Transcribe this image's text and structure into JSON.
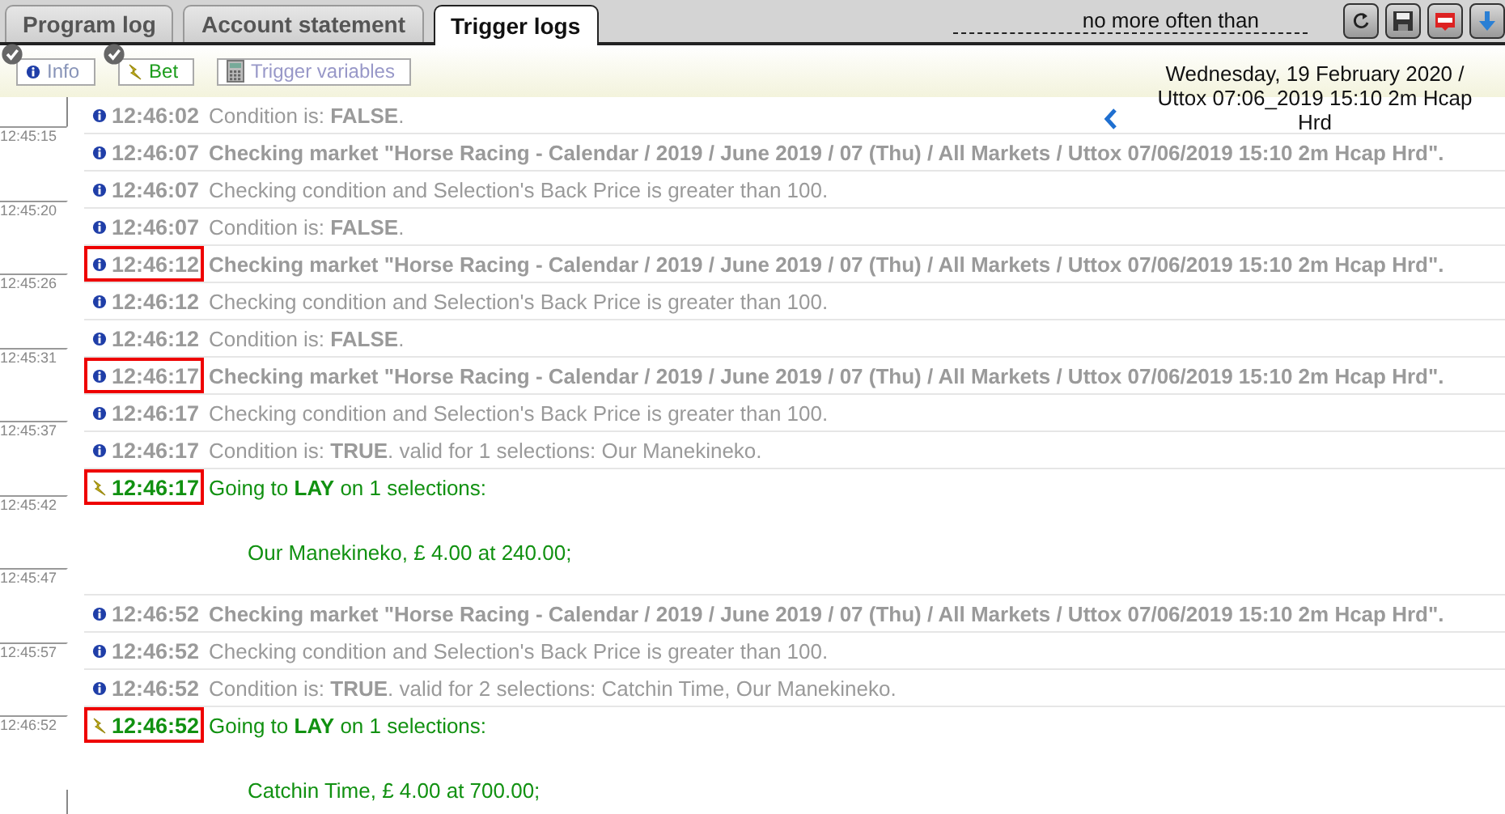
{
  "tabs": [
    {
      "label": "Program log",
      "selected": false
    },
    {
      "label": "Account statement",
      "selected": false
    },
    {
      "label": "Trigger logs",
      "selected": true
    }
  ],
  "throttle": {
    "label": "no more often than"
  },
  "filters": [
    {
      "kind": "info",
      "label": "Info",
      "checked": true
    },
    {
      "kind": "bet",
      "label": "Bet",
      "checked": true
    },
    {
      "kind": "variables",
      "label": "Trigger variables",
      "checked": false
    }
  ],
  "date_header": {
    "text": "Wednesday, 19 February 2020 / Uttox 07:06_2019 15:10 2m Hcap Hrd"
  },
  "gutter_times": [
    "12:45:15",
    "12:45:20",
    "12:45:26",
    "12:45:31",
    "12:45:37",
    "12:45:42",
    "12:45:47",
    "12:45:57",
    "12:46:52"
  ],
  "log": [
    {
      "kind": "info",
      "time": "12:46:02",
      "message": "Condition is: **FALSE**.",
      "bold": false,
      "highlighted": false
    },
    {
      "kind": "info",
      "time": "12:46:07",
      "message": "Checking market \"Horse Racing - Calendar / 2019 / June 2019 / 07 (Thu) / All Markets / Uttox 07/06/2019 15:10 2m Hcap Hrd\".",
      "bold": true,
      "highlighted": false
    },
    {
      "kind": "info",
      "time": "12:46:07",
      "message": "Checking condition and Selection's Back Price is greater than 100.",
      "bold": false,
      "highlighted": false
    },
    {
      "kind": "info",
      "time": "12:46:07",
      "message": "Condition is: **FALSE**.",
      "bold": false,
      "highlighted": false
    },
    {
      "kind": "info",
      "time": "12:46:12",
      "message": "Checking market \"Horse Racing - Calendar / 2019 / June 2019 / 07 (Thu) / All Markets / Uttox 07/06/2019 15:10 2m Hcap Hrd\".",
      "bold": true,
      "highlighted": true
    },
    {
      "kind": "info",
      "time": "12:46:12",
      "message": "Checking condition and Selection's Back Price is greater than 100.",
      "bold": false,
      "highlighted": false
    },
    {
      "kind": "info",
      "time": "12:46:12",
      "message": "Condition is: **FALSE**.",
      "bold": false,
      "highlighted": false
    },
    {
      "kind": "info",
      "time": "12:46:17",
      "message": "Checking market \"Horse Racing - Calendar / 2019 / June 2019 / 07 (Thu) / All Markets / Uttox 07/06/2019 15:10 2m Hcap Hrd\".",
      "bold": true,
      "highlighted": true
    },
    {
      "kind": "info",
      "time": "12:46:17",
      "message": "Checking condition and Selection's Back Price is greater than 100.",
      "bold": false,
      "highlighted": false
    },
    {
      "kind": "info",
      "time": "12:46:17",
      "message": "Condition is: **TRUE**. valid for 1 selections: Our Manekineko.",
      "bold": false,
      "highlighted": false
    },
    {
      "kind": "bet",
      "time": "12:46:17",
      "message": "Going to **LAY** on 1 selections:",
      "detail": "Our Manekineko, £ 4.00 at 240.00;",
      "bold": false,
      "highlighted": true
    },
    {
      "kind": "info",
      "time": "12:46:52",
      "message": "Checking market \"Horse Racing - Calendar / 2019 / June 2019 / 07 (Thu) / All Markets / Uttox 07/06/2019 15:10 2m Hcap Hrd\".",
      "bold": true,
      "highlighted": false
    },
    {
      "kind": "info",
      "time": "12:46:52",
      "message": "Checking condition and Selection's Back Price is greater than 100.",
      "bold": false,
      "highlighted": false
    },
    {
      "kind": "info",
      "time": "12:46:52",
      "message": "Condition is: **TRUE**. valid for 2 selections: Catchin Time, Our Manekineko.",
      "bold": false,
      "highlighted": false
    },
    {
      "kind": "bet",
      "time": "12:46:52",
      "message": "Going to **LAY** on 1 selections:",
      "detail": "Catchin Time, £ 4.00 at 700.00;",
      "bold": false,
      "highlighted": true
    }
  ]
}
